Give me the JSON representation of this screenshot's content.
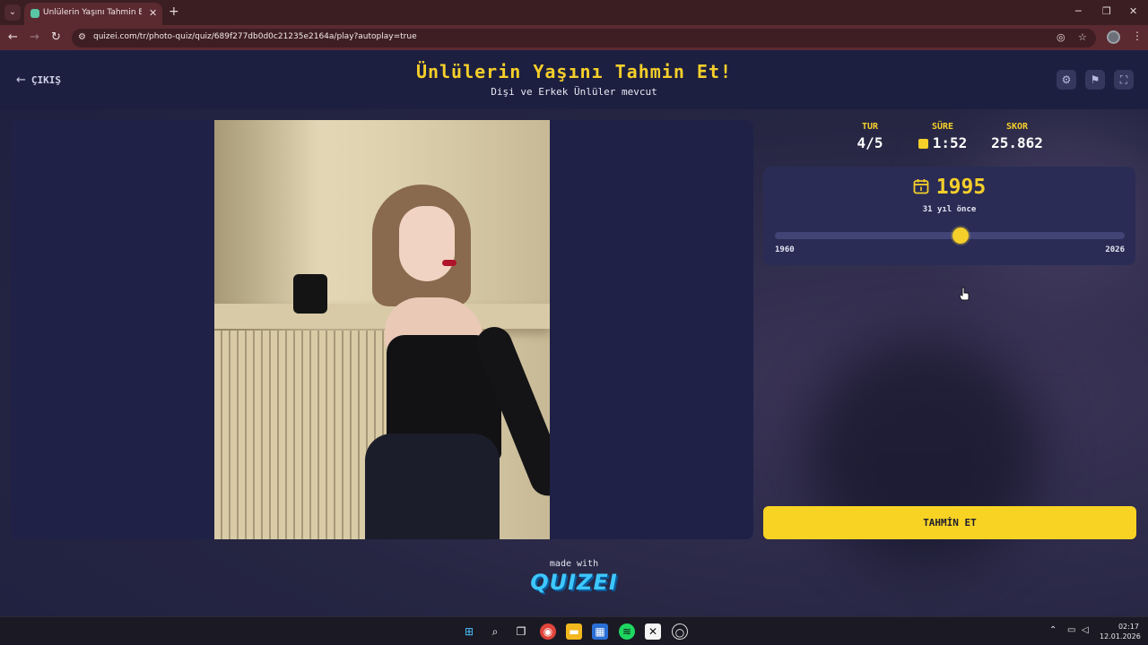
{
  "browser": {
    "tab_title": "Ünlülerin Yaşını Tahmin Et! - Qu",
    "url": "quizei.com/tr/photo-quiz/quiz/689f277db0d0c21235e2164a/play?autoplay=true"
  },
  "header": {
    "exit_label": "ÇIKIŞ",
    "title": "Ünlülerin Yaşını Tahmin Et!",
    "subtitle": "Dişi ve Erkek Ünlüler mevcut"
  },
  "stats": {
    "round_label": "TUR",
    "round_value": "4/5",
    "time_label": "SÜRE",
    "time_value": "1:52",
    "score_label": "SKOR",
    "score_value": "25.862"
  },
  "guess": {
    "year": "1995",
    "years_ago": "31 yıl önce",
    "slider_min": "1960",
    "slider_max": "2026",
    "slider_value": 1995
  },
  "submit_label": "TAHMİN ET",
  "footer": {
    "made_with": "made with",
    "logo_text": "QUIZEI"
  },
  "taskbar": {
    "clock_time": "02:17",
    "clock_date": "12.01.2026"
  },
  "colors": {
    "accent": "#f5cf2a",
    "background": "#1b1d3d",
    "panel": "#2a2c55",
    "browser_chrome": "#5a2a30"
  }
}
